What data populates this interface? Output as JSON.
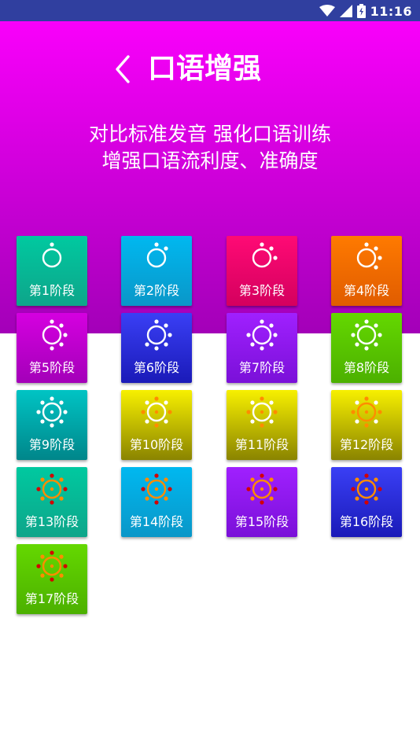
{
  "status_bar": {
    "time": "11:16",
    "icons": [
      "wifi-icon",
      "signal-icon",
      "battery-icon"
    ]
  },
  "header": {
    "title": "口语增强",
    "back_icon": "chevron-left-icon"
  },
  "subtitle": {
    "line1": "对比标准发音  强化口语训练",
    "line2": "增强口语流利度、准确度"
  },
  "colors": {
    "hero_top": "#ff00ff",
    "hero_bottom": "#a300b8",
    "status_bar": "#303f9f"
  },
  "stages": [
    {
      "label": "第1阶段",
      "top": "#00c9a0",
      "bottom": "#0ea58a",
      "level": 1
    },
    {
      "label": "第2阶段",
      "top": "#00b8f0",
      "bottom": "#0a97c8",
      "level": 2
    },
    {
      "label": "第3阶段",
      "top": "#ff0a75",
      "bottom": "#d4005e",
      "level": 3
    },
    {
      "label": "第4阶段",
      "top": "#ff7a00",
      "bottom": "#e05c00",
      "level": 4
    },
    {
      "label": "第5阶段",
      "top": "#d500e0",
      "bottom": "#a300b8",
      "level": 5
    },
    {
      "label": "第6阶段",
      "top": "#3a3ff5",
      "bottom": "#1a1ab8",
      "level": 6
    },
    {
      "label": "第7阶段",
      "top": "#a020ff",
      "bottom": "#7a10d8",
      "level": 7
    },
    {
      "label": "第8阶段",
      "top": "#64d800",
      "bottom": "#4cb000",
      "level": 8
    },
    {
      "label": "第9阶段",
      "top": "#00c4c4",
      "bottom": "#00868a",
      "level": 9
    },
    {
      "label": "第10阶段",
      "top": "#f7f000",
      "bottom": "#8a8400",
      "level": 10
    },
    {
      "label": "第11阶段",
      "top": "#f7f000",
      "bottom": "#8a8400",
      "level": 11
    },
    {
      "label": "第12阶段",
      "top": "#f7f000",
      "bottom": "#8a8400",
      "level": 12
    },
    {
      "label": "第13阶段",
      "top": "#00c9a0",
      "bottom": "#0ea58a",
      "level": 13
    },
    {
      "label": "第14阶段",
      "top": "#00b8f0",
      "bottom": "#0a97c8",
      "level": 14
    },
    {
      "label": "第15阶段",
      "top": "#a020ff",
      "bottom": "#7a10d8",
      "level": 15
    },
    {
      "label": "第16阶段",
      "top": "#3a3ff5",
      "bottom": "#1a1ab8",
      "level": 16
    },
    {
      "label": "第17阶段",
      "top": "#64d800",
      "bottom": "#4cb000",
      "level": 17
    }
  ]
}
